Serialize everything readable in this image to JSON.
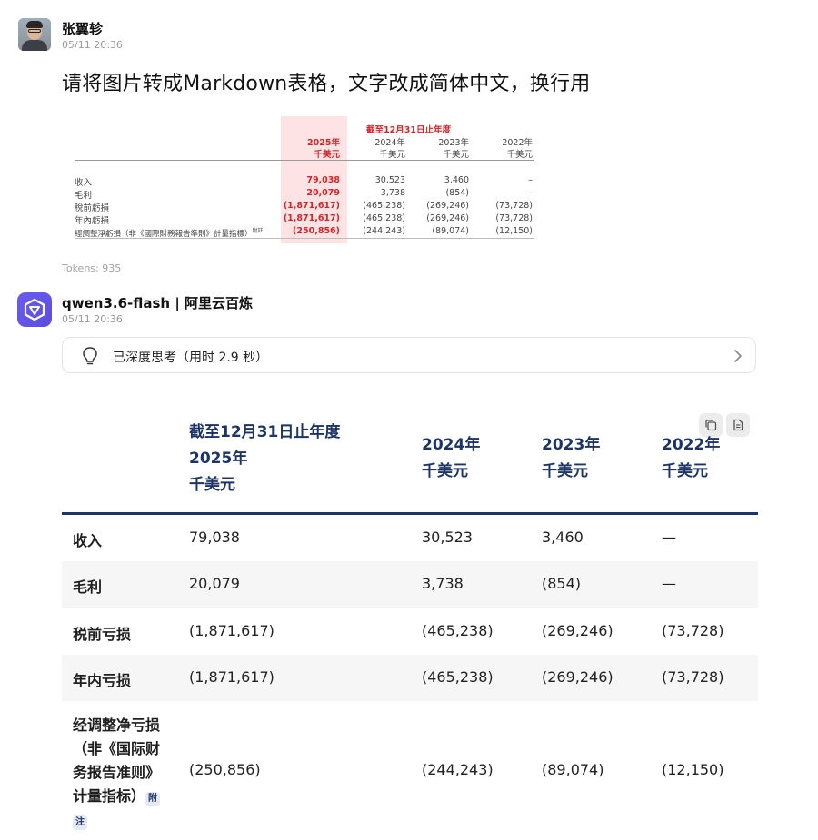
{
  "user": {
    "name": "张翼轸",
    "time": "05/11 20:36",
    "message": "请将图片转成Markdown表格，文字改成简体中文，换行用",
    "attachment": {
      "header_title": "截至12月31日止年度",
      "years": [
        "2025年",
        "2024年",
        "2023年",
        "2022年"
      ],
      "units": [
        "千美元",
        "千美元",
        "千美元",
        "千美元"
      ],
      "rows": [
        {
          "label": "收入",
          "values": [
            "79,038",
            "30,523",
            "3,460",
            "–"
          ]
        },
        {
          "label": "毛利",
          "values": [
            "20,079",
            "3,738",
            "(854)",
            "–"
          ]
        },
        {
          "label": "稅前虧損",
          "values": [
            "(1,871,617)",
            "(465,238)",
            "(269,246)",
            "(73,728)"
          ]
        },
        {
          "label": "年內虧損",
          "values": [
            "(1,871,617)",
            "(465,238)",
            "(269,246)",
            "(73,728)"
          ]
        },
        {
          "label": "經調整淨虧損（非《國際財務報告準則》計量指標）",
          "note": "附註",
          "values": [
            "(250,856)",
            "(244,243)",
            "(89,074)",
            "(12,150)"
          ]
        }
      ]
    },
    "tokens": "Tokens: 935"
  },
  "assistant": {
    "name": "qwen3.6-flash | 阿里云百炼",
    "time": "05/11 20:36",
    "thinking_label": "已深度思考（用时 2.9 秒）",
    "icons": [
      "lightbulb-icon",
      "chevron-right-icon",
      "copy-icon",
      "document-icon"
    ],
    "table": {
      "header": {
        "col1": [
          "截至12月31日止年度",
          "2025年",
          "千美元"
        ],
        "col2": [
          "2024年",
          "千美元"
        ],
        "col3": [
          "2023年",
          "千美元"
        ],
        "col4": [
          "2022年",
          "千美元"
        ]
      },
      "rows": [
        {
          "label": "收入",
          "values": [
            "79,038",
            "30,523",
            "3,460",
            "—"
          ]
        },
        {
          "label": "毛利",
          "values": [
            "20,079",
            "3,738",
            "(854)",
            "—"
          ]
        },
        {
          "label": "税前亏损",
          "values": [
            "(1,871,617)",
            "(465,238)",
            "(269,246)",
            "(73,728)"
          ]
        },
        {
          "label": "年内亏损",
          "values": [
            "(1,871,617)",
            "(465,238)",
            "(269,246)",
            "(73,728)"
          ]
        },
        {
          "label_lines": [
            "经调整净亏损",
            "（非《国际财",
            "务报告准则》",
            "计量指标）"
          ],
          "note_a": "附",
          "note_b": "注",
          "values": [
            "(250,856)",
            "(244,243)",
            "(89,074)",
            "(12,150)"
          ]
        }
      ]
    },
    "colors": {
      "accent": "#1d3566",
      "highlight": "#d2262c",
      "bot_avatar": "#6a5cf0"
    }
  }
}
